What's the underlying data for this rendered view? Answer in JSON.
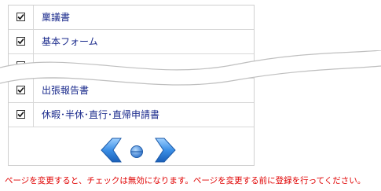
{
  "items": [
    {
      "label": "稟議書",
      "checked": true
    },
    {
      "label": "基本フォーム",
      "checked": true
    },
    {
      "label": "",
      "checked": true
    },
    {
      "label": "出張報告書",
      "checked": true
    },
    {
      "label": "休暇･半休･直行･直帰申請書",
      "checked": true
    }
  ],
  "pager": {
    "prev_icon": "left-arrow-icon",
    "current_icon": "page-dot-icon",
    "next_icon": "right-arrow-icon"
  },
  "note": "ページを変更すると、チェックは無効になります。ページを変更する前に登録を行ってください。",
  "colors": {
    "link": "#1a2a8c",
    "warning": "#e00000",
    "arrow": "#2a7ad8"
  }
}
